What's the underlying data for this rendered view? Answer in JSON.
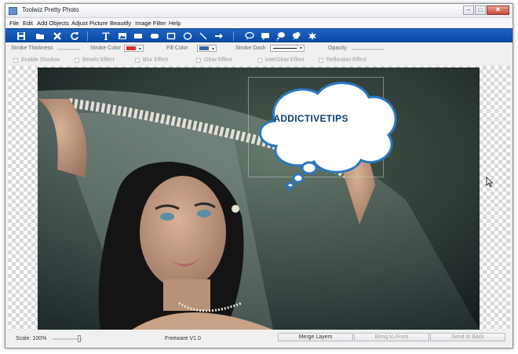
{
  "window": {
    "title": "Toolwiz Pretty Photo",
    "minimize_label": "–",
    "maximize_label": "□",
    "close_label": "✕"
  },
  "menu": [
    "File",
    "Edit",
    "Add Objects",
    "Adjust Picture",
    "Beautify",
    "Image Filter",
    "Help"
  ],
  "toolbar": {
    "icons": [
      "save-icon",
      "open-icon",
      "delete-icon",
      "refresh-icon",
      "text-icon",
      "image-icon",
      "rectangle-icon",
      "rounded-rectangle-icon",
      "square-outline-icon",
      "ellipse-icon",
      "line-icon",
      "arrow-icon",
      "speech-bubble-icon",
      "comment-bubble-icon",
      "thought-bubble-icon",
      "cloud-bubble-icon",
      "splash-icon"
    ]
  },
  "properties": {
    "stroke_thickness": "Stroke Thickness",
    "stroke_color": "Stroke Color",
    "stroke_color_value": "#d93030",
    "fill_color": "Fill Color",
    "fill_color_value": "#3a66b0",
    "stroke_dash": "Stroke Dash",
    "opacity": "Opacity",
    "dropdown_arrow": "▾"
  },
  "effects": [
    "Enable Shadow",
    "Bevels Effect",
    "Blur Effect",
    "Glow Effect",
    "InterGlow Effect",
    "Reflection Effect"
  ],
  "canvas": {
    "callout_text": "ADDICTIVETIPS"
  },
  "status": {
    "scale": "Scale: 100%",
    "version": "Freeware V1.0",
    "merge_layers": "Merge Layers",
    "bring_to_front": "Bring to Front",
    "send_to_back": "Send to Back"
  },
  "colors": {
    "toolbar_blue": "#1255b8",
    "callout_text": "#0c3d6e"
  }
}
